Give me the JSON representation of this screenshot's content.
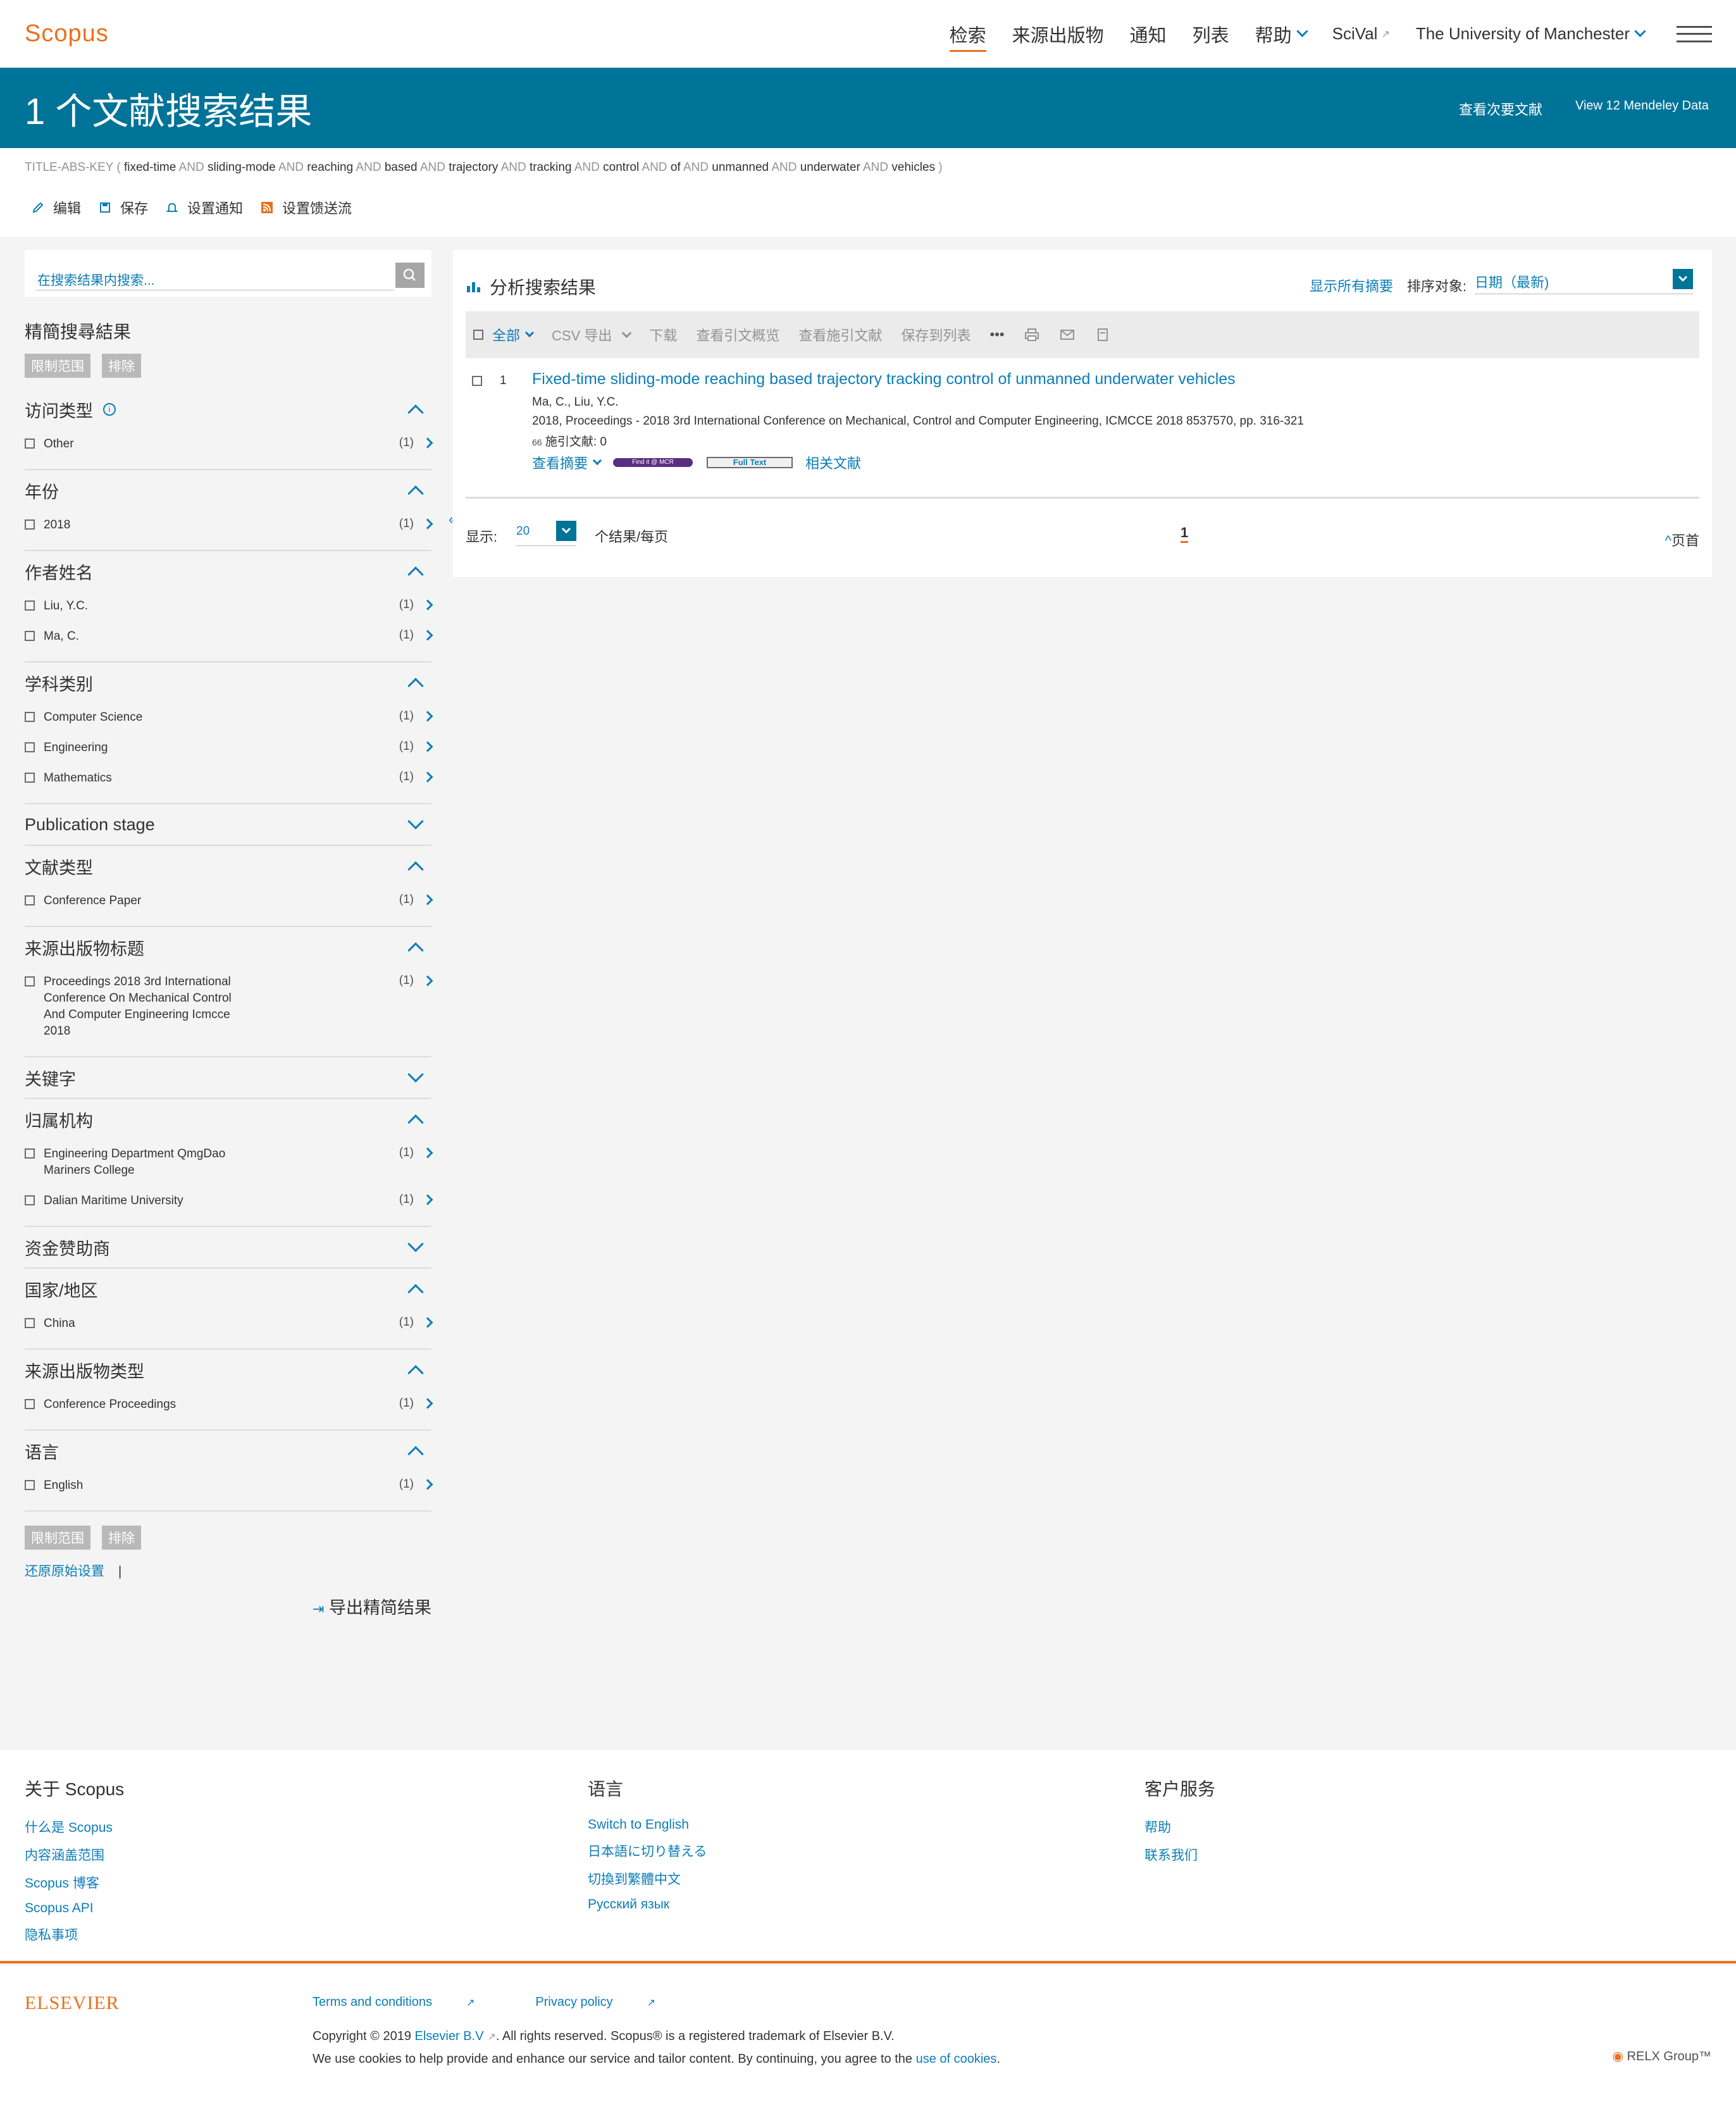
{
  "header": {
    "logo": "Scopus",
    "nav": [
      {
        "label": "检索",
        "active": true
      },
      {
        "label": "来源出版物"
      },
      {
        "label": "通知"
      },
      {
        "label": "列表"
      },
      {
        "label": "帮助"
      }
    ],
    "scival": "SciVal",
    "institution": "The University of Manchester"
  },
  "banner": {
    "title": "1 个文献搜索结果",
    "secondary": "查看次要文献",
    "mendeley": "View 12 Mendeley Data"
  },
  "query": {
    "prefix": "TITLE-ABS-KEY (",
    "terms": [
      "fixed-time",
      "sliding-mode",
      "reaching",
      "based",
      "trajectory",
      "tracking",
      "control",
      "of",
      "unmanned",
      "underwater",
      "vehicles"
    ],
    "operator": "AND",
    "suffix": ")"
  },
  "actions": [
    "编辑",
    "保存",
    "设置通知",
    "设置馈送流"
  ],
  "sidebar": {
    "search_placeholder": "在搜索结果内搜索...",
    "refine_title": "精簡搜尋結果",
    "limit_label": "限制范围",
    "exclude_label": "排除",
    "facets": [
      {
        "title": "访问类型",
        "info": true,
        "expanded": true,
        "items": [
          {
            "label": "Other",
            "count": "(1)"
          }
        ]
      },
      {
        "title": "年份",
        "expanded": true,
        "items": [
          {
            "label": "2018",
            "count": "(1)"
          }
        ]
      },
      {
        "title": "作者姓名",
        "expanded": true,
        "items": [
          {
            "label": "Liu, Y.C.",
            "count": "(1)"
          },
          {
            "label": "Ma, C.",
            "count": "(1)"
          }
        ]
      },
      {
        "title": "学科类别",
        "expanded": true,
        "items": [
          {
            "label": "Computer Science",
            "count": "(1)"
          },
          {
            "label": "Engineering",
            "count": "(1)"
          },
          {
            "label": "Mathematics",
            "count": "(1)"
          }
        ]
      },
      {
        "title": "Publication stage",
        "expanded": false,
        "items": []
      },
      {
        "title": "文献类型",
        "expanded": true,
        "items": [
          {
            "label": "Conference Paper",
            "count": "(1)"
          }
        ]
      },
      {
        "title": "来源出版物标题",
        "expanded": true,
        "items": [
          {
            "label": "Proceedings 2018 3rd International Conference On Mechanical Control And Computer Engineering Icmcce 2018",
            "count": "(1)"
          }
        ]
      },
      {
        "title": "关键字",
        "expanded": false,
        "items": []
      },
      {
        "title": "归属机构",
        "expanded": true,
        "items": [
          {
            "label": "Engineering Department QmgDao Mariners College",
            "count": "(1)"
          },
          {
            "label": "Dalian Maritime University",
            "count": "(1)"
          }
        ]
      },
      {
        "title": "资金赞助商",
        "expanded": false,
        "items": []
      },
      {
        "title": "国家/地区",
        "expanded": true,
        "items": [
          {
            "label": "China",
            "count": "(1)"
          }
        ]
      },
      {
        "title": "来源出版物类型",
        "expanded": true,
        "items": [
          {
            "label": "Conference Proceedings",
            "count": "(1)"
          }
        ]
      },
      {
        "title": "语言",
        "expanded": true,
        "items": [
          {
            "label": "English",
            "count": "(1)"
          }
        ]
      }
    ],
    "reset_label": "还原原始设置",
    "export_label": "导出精简结果"
  },
  "main": {
    "analyze_label": "分析搜索结果",
    "show_abstracts": "显示所有摘要",
    "sort_label": "排序对象:",
    "sort_value": "日期（最新)",
    "toolbar": {
      "all": "全部",
      "csv_export": "CSV 导出",
      "download": "下载",
      "citation_overview": "查看引文概览",
      "cited_by": "查看施引文献",
      "save_to_list": "保存到列表",
      "more": "•••"
    },
    "results": [
      {
        "num": "1",
        "title": "Fixed-time sliding-mode reaching based trajectory tracking control of unmanned underwater vehicles",
        "authors": "Ma, C., Liu, Y.C.",
        "source": "2018, Proceedings - 2018 3rd International Conference on Mechanical, Control and Computer Engineering, ICMCCE 2018 8537570, pp. 316-321",
        "cited": "施引文献: 0",
        "view_abstract": "查看摘要",
        "findit": "Find it @ MCR",
        "fulltext": "Full Text",
        "related": "相关文献"
      }
    ],
    "pager": {
      "show_label": "显示:",
      "per_page_value": "20",
      "per_page_suffix": "个结果/每页",
      "current_page": "1",
      "top_label": "页首"
    }
  },
  "footer": {
    "about_title": "关于 Scopus",
    "about_links": [
      "什么是 Scopus",
      "内容涵盖范围",
      "Scopus 博客",
      "Scopus API",
      "隐私事项"
    ],
    "lang_title": "语言",
    "lang_links": [
      "Switch to English",
      "日本語に切り替える",
      "切換到繁體中文",
      "Русский язык"
    ],
    "service_title": "客户服务",
    "service_links": [
      "帮助",
      "联系我们"
    ],
    "elsevier": "ELSEVIER",
    "terms": "Terms and conditions",
    "privacy": "Privacy policy",
    "copyright_pre": "Copyright © 2019 ",
    "copyright_link": "Elsevier B.V",
    "copyright_post": ". All rights reserved. Scopus® is a registered trademark of Elsevier B.V.",
    "cookies_pre": "We use cookies to help provide and enhance our service and tailor content. By continuing, you agree to the ",
    "cookies_link": "use of cookies",
    "relx": "RELX Group™"
  },
  "colors": {
    "brand": "#e9711c",
    "banner": "#007398",
    "link": "#0c7db7"
  }
}
